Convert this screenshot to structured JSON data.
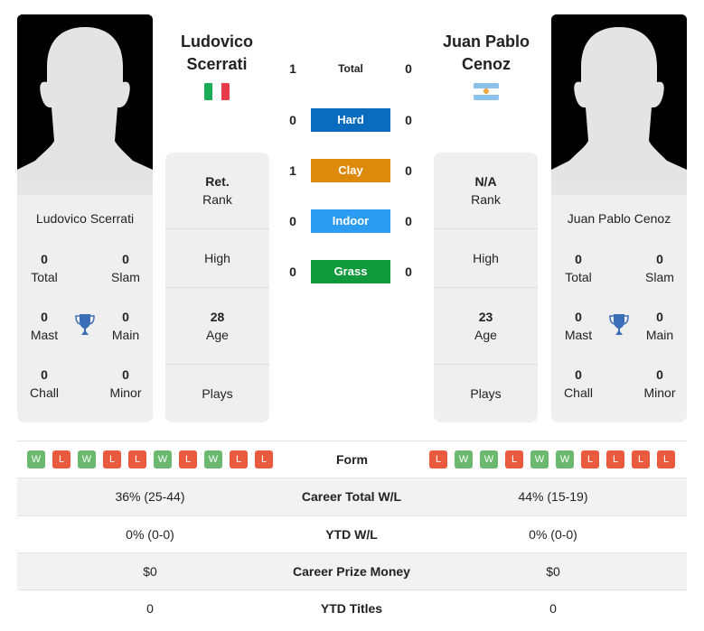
{
  "players": {
    "left": {
      "name": "Ludovico Scerrati",
      "header_line1": "Ludovico",
      "header_line2": "Scerrati",
      "country_flag": "italy-flag",
      "flag_colors": [
        "#1aad57",
        "#ffffff",
        "#e53b4b"
      ],
      "titles": {
        "total": {
          "value": "0",
          "label": "Total"
        },
        "slam": {
          "value": "0",
          "label": "Slam"
        },
        "mast": {
          "value": "0",
          "label": "Mast"
        },
        "main": {
          "value": "0",
          "label": "Main"
        },
        "chall": {
          "value": "0",
          "label": "Chall"
        },
        "minor": {
          "value": "0",
          "label": "Minor"
        }
      },
      "info": {
        "rank_value": "Ret.",
        "rank_label": "Rank",
        "high_label": "High",
        "age_value": "28",
        "age_label": "Age",
        "plays_label": "Plays"
      },
      "form": [
        "W",
        "L",
        "W",
        "L",
        "L",
        "W",
        "L",
        "W",
        "L",
        "L"
      ]
    },
    "right": {
      "name": "Juan Pablo Cenoz",
      "header_line1": "Juan Pablo",
      "header_line2": "Cenoz",
      "country_flag": "argentina-flag",
      "flag_colors": [
        "#8cc1ea",
        "#ffffff",
        "#f0a940"
      ],
      "titles": {
        "total": {
          "value": "0",
          "label": "Total"
        },
        "slam": {
          "value": "0",
          "label": "Slam"
        },
        "mast": {
          "value": "0",
          "label": "Mast"
        },
        "main": {
          "value": "0",
          "label": "Main"
        },
        "chall": {
          "value": "0",
          "label": "Chall"
        },
        "minor": {
          "value": "0",
          "label": "Minor"
        }
      },
      "info": {
        "rank_value": "N/A",
        "rank_label": "Rank",
        "high_label": "High",
        "age_value": "23",
        "age_label": "Age",
        "plays_label": "Plays"
      },
      "form": [
        "L",
        "W",
        "W",
        "L",
        "W",
        "W",
        "L",
        "L",
        "L",
        "L"
      ]
    }
  },
  "h2h": [
    {
      "label": "Total",
      "left": "1",
      "right": "0",
      "color": ""
    },
    {
      "label": "Hard",
      "left": "0",
      "right": "0",
      "color": "#0a6bbf"
    },
    {
      "label": "Clay",
      "left": "1",
      "right": "0",
      "color": "#dd8a0a"
    },
    {
      "label": "Indoor",
      "left": "0",
      "right": "0",
      "color": "#2b9cf2"
    },
    {
      "label": "Grass",
      "left": "0",
      "right": "0",
      "color": "#109a3c"
    }
  ],
  "form_label": "Form",
  "stats": [
    {
      "label": "Career Total W/L",
      "left": "36% (25-44)",
      "right": "44% (15-19)"
    },
    {
      "label": "YTD W/L",
      "left": "0% (0-0)",
      "right": "0% (0-0)"
    },
    {
      "label": "Career Prize Money",
      "left": "$0",
      "right": "$0"
    },
    {
      "label": "YTD Titles",
      "left": "0",
      "right": "0"
    }
  ],
  "colors": {
    "win": "#6ab96e",
    "loss": "#ea5a3e",
    "trophy": "#3a6fb8",
    "card_bg": "#efefef"
  }
}
